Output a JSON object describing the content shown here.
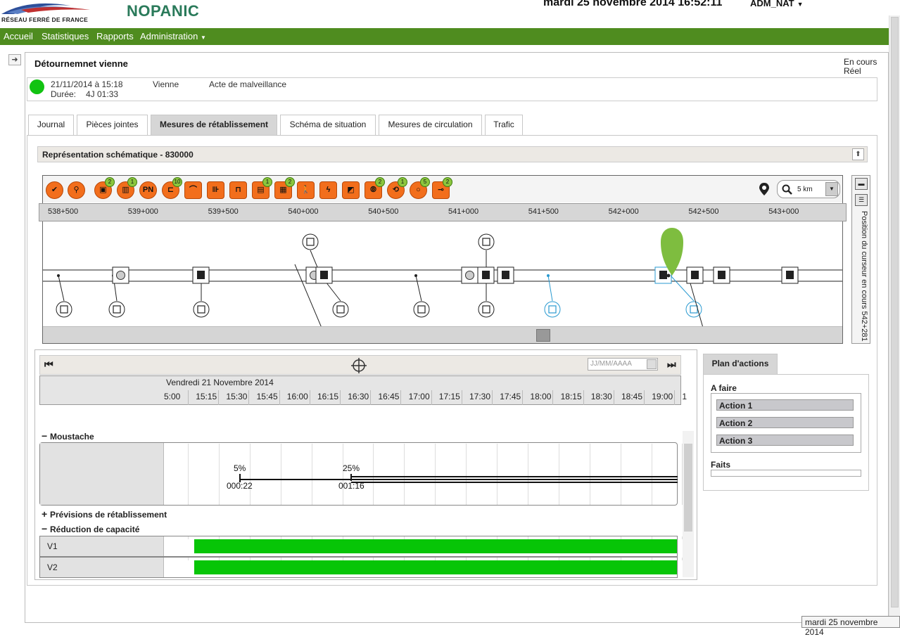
{
  "header": {
    "logo_text": "RÉSEAU FERRÉ DE FRANCE",
    "app_name": "NOPANIC",
    "datetime": "mardi 25 novembre 2014 16:52:11",
    "user": "ADM_NAT"
  },
  "nav": {
    "items": [
      "Accueil",
      "Statistiques",
      "Rapports",
      "Administration"
    ]
  },
  "incident": {
    "title": "Détournemnet vienne",
    "status": "En cours",
    "mode": "Réel",
    "date": "21/11/2014 à 15:18",
    "duration_label": "Durée:",
    "duration": "4J 01:33",
    "location": "Vienne",
    "type": "Acte de malveillance",
    "status_color": "#12c312"
  },
  "tabs": [
    "Journal",
    "Pièces jointes",
    "Mesures de rétablissement",
    "Schéma de situation",
    "Mesures de circulation",
    "Trafic"
  ],
  "active_tab": "Mesures de rétablissement",
  "schematic": {
    "title": "Représentation schématique - 830000",
    "toolbar_icons": [
      {
        "icon": "check-icon",
        "badge": ""
      },
      {
        "icon": "pin-icon",
        "badge": ""
      },
      {
        "icon": "station-icon",
        "badge": "2"
      },
      {
        "icon": "crossing-icon",
        "badge": "1"
      },
      {
        "icon": "pn-icon",
        "label": "PN",
        "badge": ""
      },
      {
        "icon": "signal-icon",
        "badge": "10"
      },
      {
        "icon": "bridge-icon",
        "badge": ""
      },
      {
        "icon": "switch-icon",
        "badge": ""
      },
      {
        "icon": "tunnel-icon",
        "badge": ""
      },
      {
        "icon": "train-icon",
        "badge": "1"
      },
      {
        "icon": "wagons-icon",
        "badge": "2"
      },
      {
        "icon": "pedestrian-icon",
        "badge": ""
      },
      {
        "icon": "lightning-icon",
        "badge": ""
      },
      {
        "icon": "slope-icon",
        "badge": ""
      },
      {
        "icon": "antenna-icon",
        "badge": "2"
      },
      {
        "icon": "rotate-icon",
        "badge": "1"
      },
      {
        "icon": "circle-icon",
        "badge": "5"
      },
      {
        "icon": "plug-icon",
        "badge": "2"
      }
    ],
    "zoom": "5 km",
    "km_marks": [
      "538+500",
      "539+000",
      "539+500",
      "540+000",
      "540+500",
      "541+000",
      "541+500",
      "542+000",
      "542+500",
      "543+000"
    ],
    "cursor_position": "Position du curseur en cours 542+281",
    "accent_color": "#f26e1c",
    "badge_color": "#8cc63e",
    "marker_color": "#7ebd3f"
  },
  "timeline": {
    "date_placeholder": "JJ/MM/AAAA",
    "day": "Vendredi 21 Novembre 2014",
    "ticks": [
      "5:00",
      "15:15",
      "15:30",
      "15:45",
      "16:00",
      "16:15",
      "16:30",
      "16:45",
      "17:00",
      "17:15",
      "17:30",
      "17:45",
      "18:00",
      "18:15",
      "18:30",
      "18:45",
      "19:00",
      "1"
    ],
    "groups": {
      "moustache": "Moustache",
      "previsions": "Prévisions de rétablissement",
      "reduction": "Réduction de capacité"
    },
    "moustache_marks": [
      {
        "pct": "5%",
        "time": "000:22"
      },
      {
        "pct": "25%",
        "time": "001:16"
      }
    ],
    "capacity_rows": [
      "V1",
      "V2"
    ],
    "bar_color": "#07c507"
  },
  "plan": {
    "tab": "Plan d'actions",
    "todo_label": "A faire",
    "actions": [
      "Action 1",
      "Action 2",
      "Action 3"
    ],
    "done_label": "Faits"
  },
  "footer_date": "mardi 25 novembre 2014"
}
